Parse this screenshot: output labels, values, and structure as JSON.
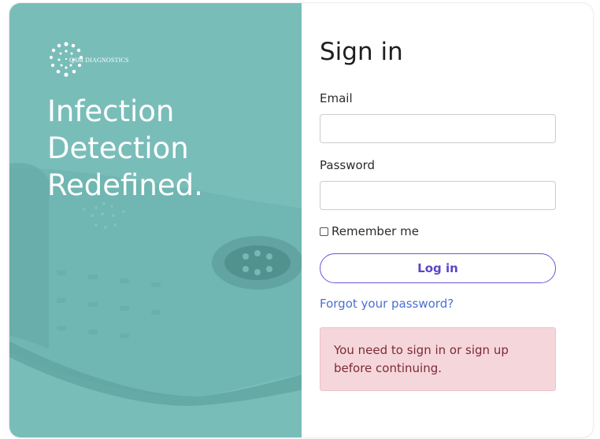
{
  "brand": {
    "logo_text": "QSM DIAGNOSTICS",
    "tagline": [
      "Infection",
      "Detection",
      "Redefined."
    ],
    "colors": {
      "hero_teal": "#79bdb9",
      "accent_purple": "#5a46c6",
      "link_blue": "#4a6fcf",
      "alert_bg": "#f5d7db",
      "alert_text": "#7d2a35"
    }
  },
  "form": {
    "title": "Sign in",
    "email_label": "Email",
    "email_value": "",
    "password_label": "Password",
    "password_value": "",
    "remember_label": "Remember me",
    "remember_checked": false,
    "login_label": "Log in",
    "forgot_label": "Forgot your password?"
  },
  "alert": {
    "message": "You need to sign in or sign up before continuing."
  }
}
